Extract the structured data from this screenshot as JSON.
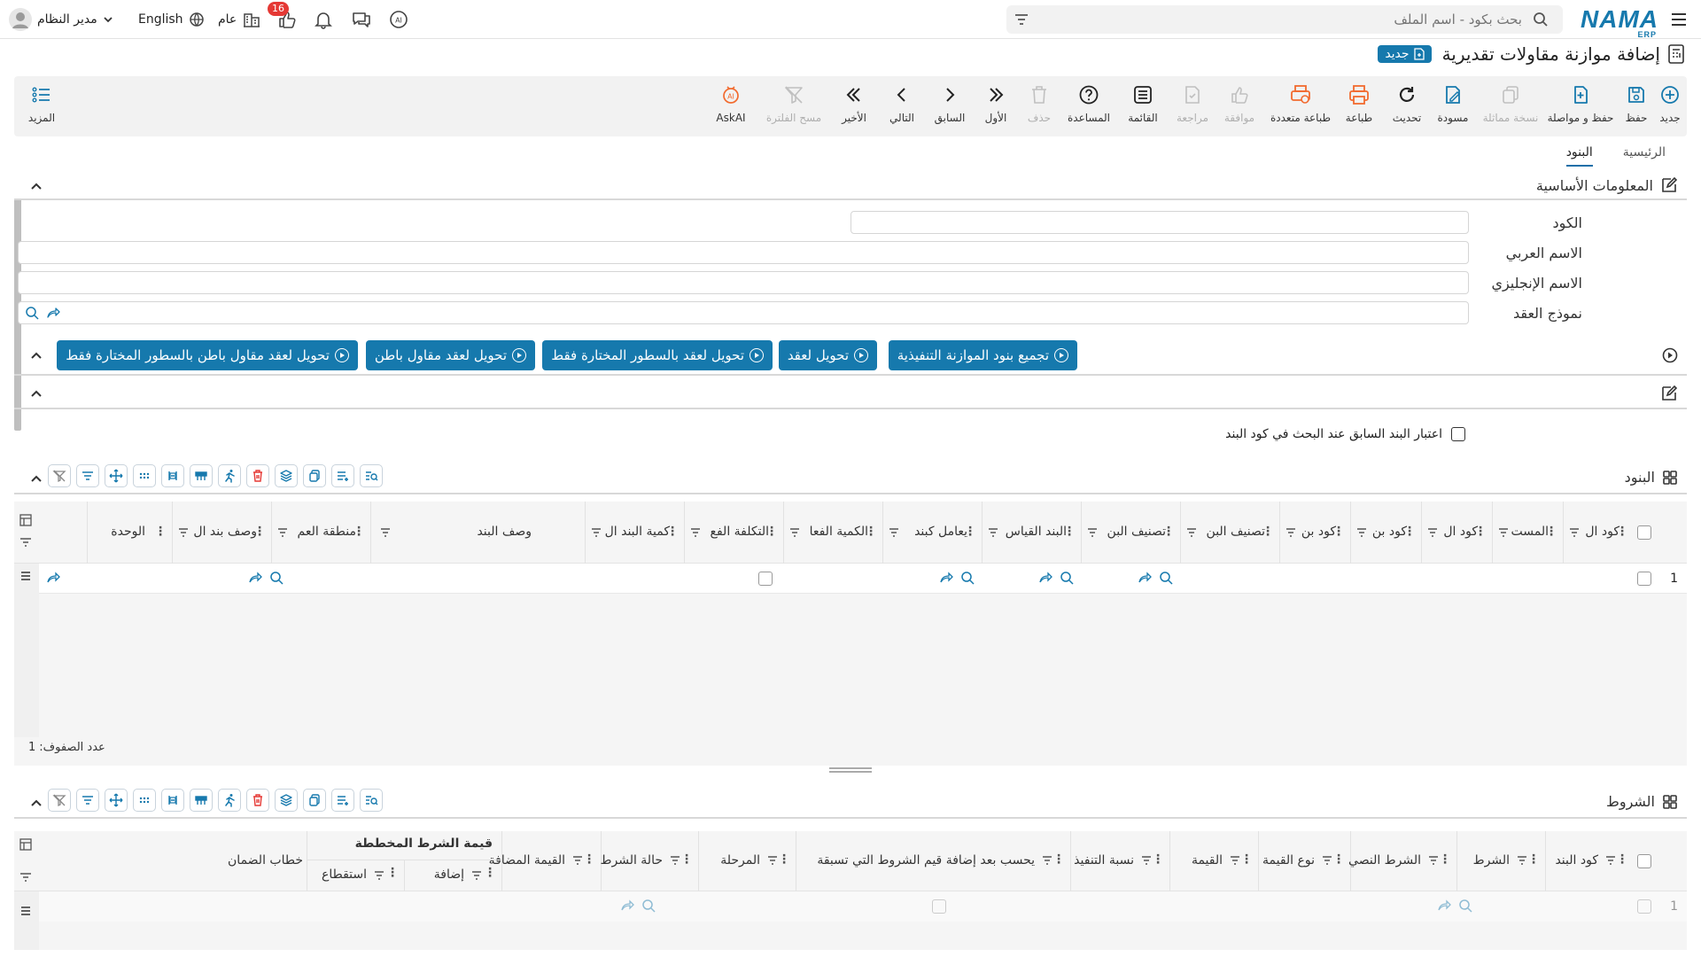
{
  "app": {
    "brand": "NAMA",
    "brand_sub": "ERP"
  },
  "topbar": {
    "search_placeholder": "بحث بكود - اسم الملف",
    "user_name": "مدير النظام",
    "language": "English",
    "scope_label": "عام",
    "notif_badge": "16"
  },
  "page": {
    "title": "إضافة موازنة مقاولات تقديرية",
    "new_badge": "جديد"
  },
  "toolbar": {
    "items": [
      {
        "label": "جديد",
        "icon": "plus-circle-icon"
      },
      {
        "label": "حفظ",
        "icon": "save-icon"
      },
      {
        "label": "حفظ و مواصلة",
        "icon": "save-continue-icon"
      },
      {
        "label": "نسخة مماثلة",
        "icon": "copy-icon"
      },
      {
        "label": "مسودة",
        "icon": "draft-icon"
      },
      {
        "label": "تحديث",
        "icon": "refresh-icon"
      },
      {
        "label": "طباعة",
        "icon": "print-icon"
      },
      {
        "label": "طباعة متعددة",
        "icon": "multi-print-icon"
      },
      {
        "label": "موافقة",
        "icon": "approve-icon"
      },
      {
        "label": "مراجعة",
        "icon": "review-icon"
      },
      {
        "label": "القائمة",
        "icon": "list-icon"
      },
      {
        "label": "المساعدة",
        "icon": "help-icon"
      },
      {
        "label": "حذف",
        "icon": "delete-icon"
      },
      {
        "label": "الأول",
        "icon": "first-icon"
      },
      {
        "label": "السابق",
        "icon": "previous-icon"
      },
      {
        "label": "التالي",
        "icon": "next-icon"
      },
      {
        "label": "الأخير",
        "icon": "last-icon"
      },
      {
        "label": "مسح الفلترة",
        "icon": "clear-filter-icon"
      },
      {
        "label": "AskAI",
        "icon": "ai-icon"
      }
    ],
    "more_label": "المزيد"
  },
  "tabs": [
    {
      "label": "الرئيسية"
    },
    {
      "label": "البنود"
    }
  ],
  "basic_info": {
    "title": "المعلومات الأساسية",
    "fields": [
      {
        "label": "الكود",
        "value": ""
      },
      {
        "label": "الاسم العربي",
        "value": ""
      },
      {
        "label": "الاسم الإنجليزي",
        "value": ""
      },
      {
        "label": "نموذج العقد",
        "value": ""
      }
    ]
  },
  "actions": [
    {
      "label": "تجميع بنود الموازنة التنفيذية"
    },
    {
      "label": "تحويل لعقد"
    },
    {
      "label": "تحويل لعقد بالسطور المختارة فقط"
    },
    {
      "label": "تحويل لعقد مقاول باطن"
    },
    {
      "label": "تحويل لعقد مقاول باطن بالسطور المختارة فقط"
    }
  ],
  "search_option": {
    "label": "اعتبار البند السابق عند البحث في كود البند",
    "checked": false
  },
  "items_grid": {
    "title": "البنود",
    "columns": [
      "كود ال",
      "المست",
      "كود ال",
      "كود بن",
      "كود بن",
      "تصنيف البن",
      "تصنيف البن",
      "البند القياس",
      "يعامل كبند",
      "الكمية الفعا",
      "التكلفة الفع",
      "كمية البند ال",
      "وصف البند",
      "منطقة العم",
      "وصف بند ال",
      "الوحدة"
    ],
    "rows": [
      {
        "num": "1"
      }
    ],
    "row_count_label": "عدد الصفوف:",
    "row_count": "1"
  },
  "conditions_grid": {
    "title": "الشروط",
    "columns": [
      "كود البند",
      "الشرط",
      "الشرط النصي",
      "نوع القيمة",
      "القيمة",
      "نسبة التنفيذ",
      "يحسب بعد إضافة قيم الشروط التي تسبقة",
      "المرحلة",
      "حالة الشرط",
      "القيمة المضافة"
    ],
    "group_header": "قيمة الشرط المخططة",
    "group_columns": [
      "إضافة",
      "استقطاع"
    ],
    "last_column": "خطاب الضمان",
    "rows": [
      {
        "num": "1"
      }
    ]
  }
}
